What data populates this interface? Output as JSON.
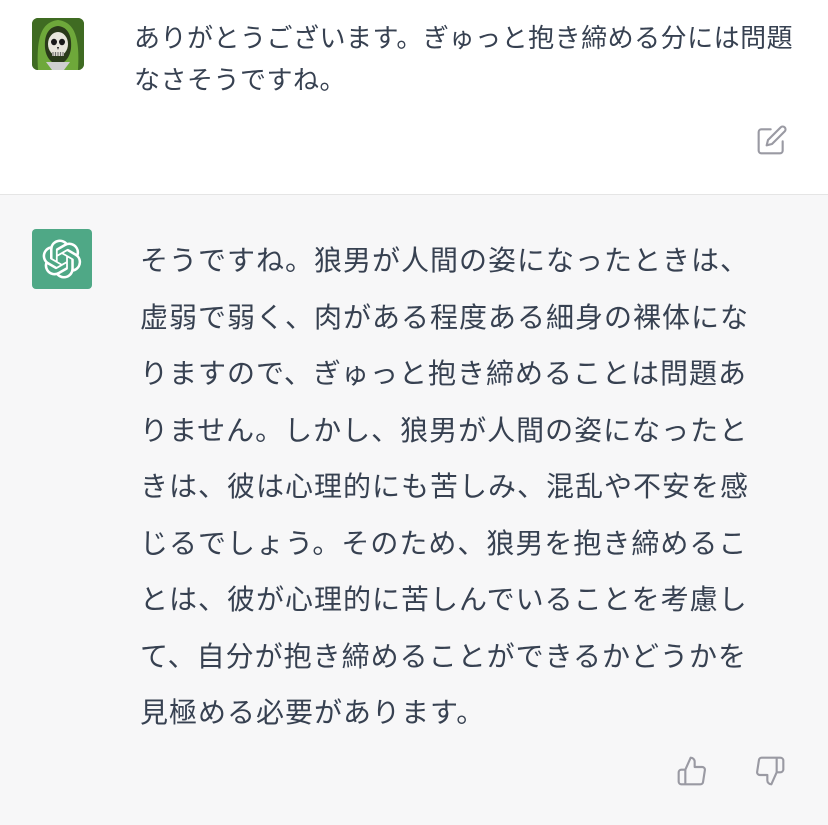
{
  "conversation": {
    "user_message": {
      "avatar_icon": "green-hooded-skull-avatar",
      "text": "ありがとうございます。ぎゅっと抱き締める分には問題なさそうですね。",
      "action_icon": "edit-icon"
    },
    "assistant_message": {
      "avatar_icon": "openai-logo-icon",
      "avatar_color": "#4fa886",
      "text": "そうですね。狼男が人間の姿になったときは、虚弱で弱く、肉がある程度ある細身の裸体になりますので、ぎゅっと抱き締めることは問題ありません。しかし、狼男が人間の姿になったときは、彼は心理的にも苦しみ、混乱や不安を感じるでしょう。そのため、狼男を抱き締めることは、彼が心理的に苦しんでいることを考慮して、自分が抱き締めることができるかどうかを見極める必要があります。",
      "feedback_icons": [
        "thumbs-up-icon",
        "thumbs-down-icon"
      ]
    },
    "colors": {
      "user_background": "#ffffff",
      "assistant_background": "#f7f7f8",
      "text": "#374151",
      "icon": "#9a9aa3"
    }
  }
}
